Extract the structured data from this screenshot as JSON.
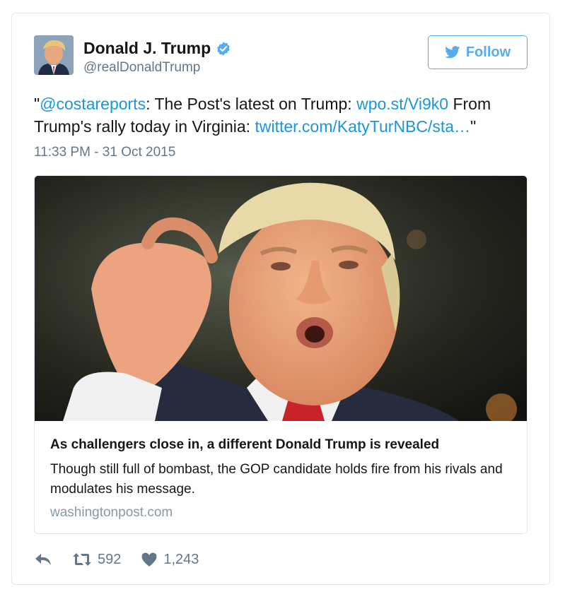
{
  "user": {
    "name": "Donald J. Trump",
    "handle": "@realDonaldTrump",
    "verified": true
  },
  "follow_button": {
    "label": "Follow"
  },
  "tweet": {
    "open_quote": "\"",
    "mention": "@costareports",
    "text_1": ": The Post's latest on Trump: ",
    "link_1": "wpo.st/Vi9k0",
    "text_2": " From Trump's rally today in Virginia: ",
    "link_2": "twitter.com/KatyTurNBC/sta…",
    "close_quote": "\"",
    "timestamp": "11:33 PM - 31 Oct 2015"
  },
  "link_card": {
    "title": "As challengers close in, a different Donald Trump is revealed",
    "description": "Though still full of bombast, the GOP candidate holds fire from his rivals and modulates his message.",
    "domain": "washingtonpost.com"
  },
  "actions": {
    "retweet_count": "592",
    "like_count": "1,243"
  },
  "colors": {
    "link": "#1b95e0",
    "follow": "#55acee",
    "muted": "#657786",
    "border": "#e1e8ed"
  },
  "icons": [
    "verified-icon",
    "twitter-bird-icon",
    "reply-icon",
    "retweet-icon",
    "heart-icon"
  ]
}
